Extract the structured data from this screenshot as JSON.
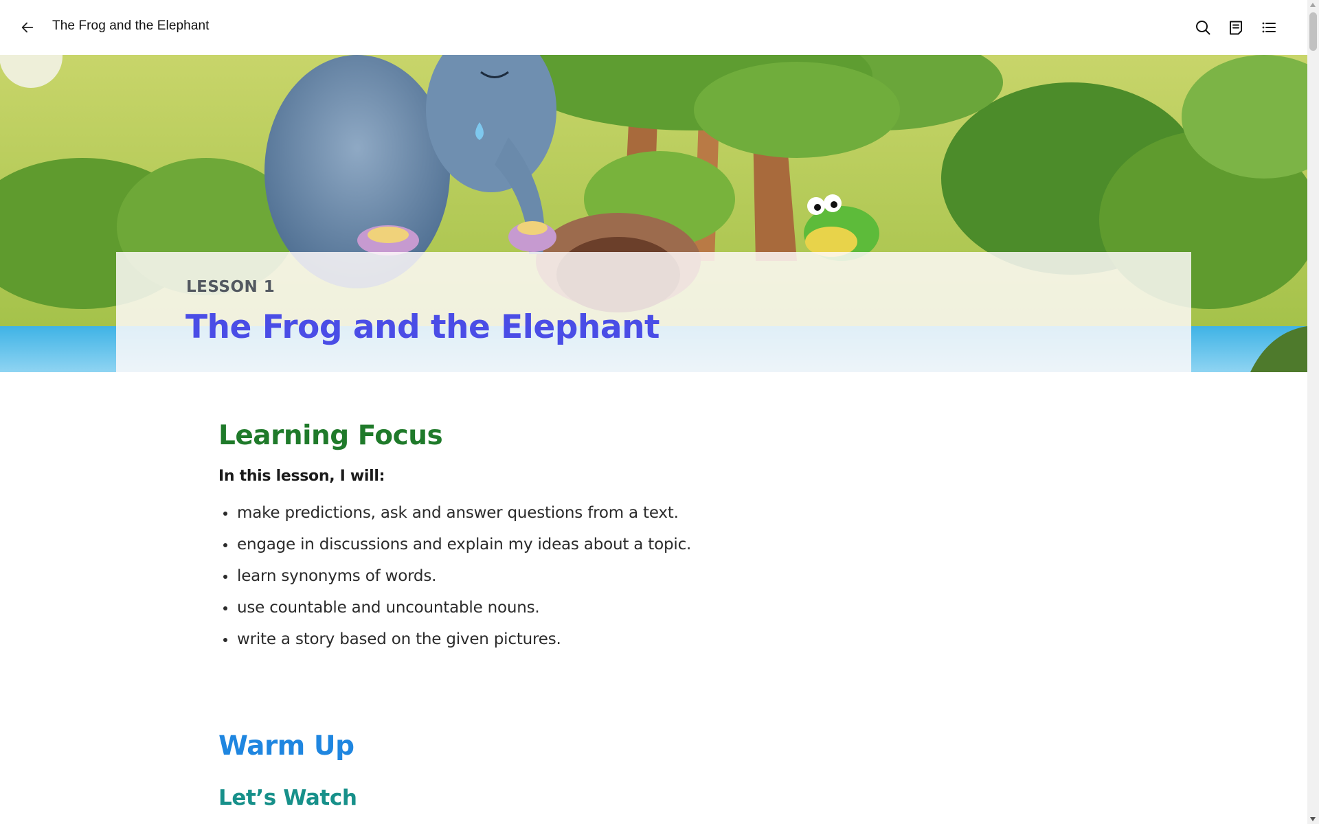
{
  "app": {
    "title": "The Frog and the Elephant"
  },
  "toolbar": {
    "back_icon": "arrow-left-icon",
    "search_icon": "search-icon",
    "notes_icon": "notes-icon",
    "contents_icon": "list-icon"
  },
  "hero": {
    "illustration": "Crying elephant and green frog in a forest by the water"
  },
  "lesson": {
    "label": "LESSON 1",
    "title": "The Frog and the Elephant"
  },
  "learning_focus": {
    "heading": "Learning Focus",
    "intro": "In this lesson, I will:",
    "items": [
      "make predictions, ask and answer questions from a text.",
      "engage in discussions and explain my ideas about a topic.",
      "learn synonyms of words.",
      "use countable and uncountable nouns.",
      "write a story based on the given pictures."
    ]
  },
  "warm_up": {
    "heading": "Warm Up",
    "subheading": "Let’s Watch"
  },
  "colors": {
    "lesson_title": "#4a4de6",
    "focus_heading": "#1f7a2a",
    "warm_heading": "#1f86e0",
    "watch_heading": "#17908a"
  }
}
